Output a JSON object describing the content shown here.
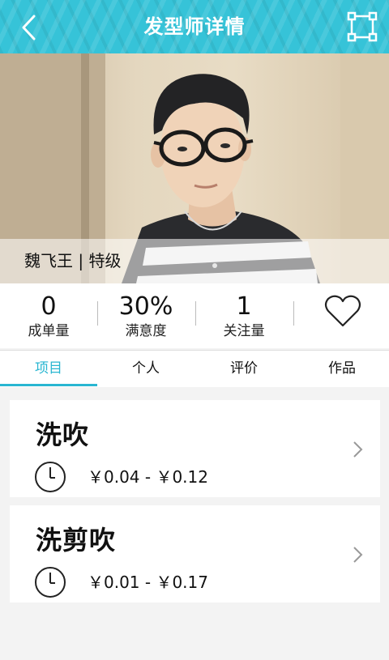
{
  "header": {
    "title": "发型师详情",
    "back_icon": "chevron-left-icon",
    "fullscreen_icon": "fullscreen-frame-icon",
    "background_color": "#36c3d8"
  },
  "stylist": {
    "name_level": "魏飞王 | 特级"
  },
  "stats": [
    {
      "value": "0",
      "label": "成单量"
    },
    {
      "value": "30%",
      "label": "满意度"
    },
    {
      "value": "1",
      "label": "关注量"
    }
  ],
  "favorite_icon": "heart-outline-icon",
  "tabs": [
    {
      "label": "项目",
      "active": true
    },
    {
      "label": "个人",
      "active": false
    },
    {
      "label": "评价",
      "active": false
    },
    {
      "label": "作品",
      "active": false
    }
  ],
  "accent_color": "#29b6d1",
  "services": [
    {
      "name": "洗吹",
      "price": "￥0.04 - ￥0.12"
    },
    {
      "name": "洗剪吹",
      "price": "￥0.01 - ￥0.17"
    }
  ]
}
